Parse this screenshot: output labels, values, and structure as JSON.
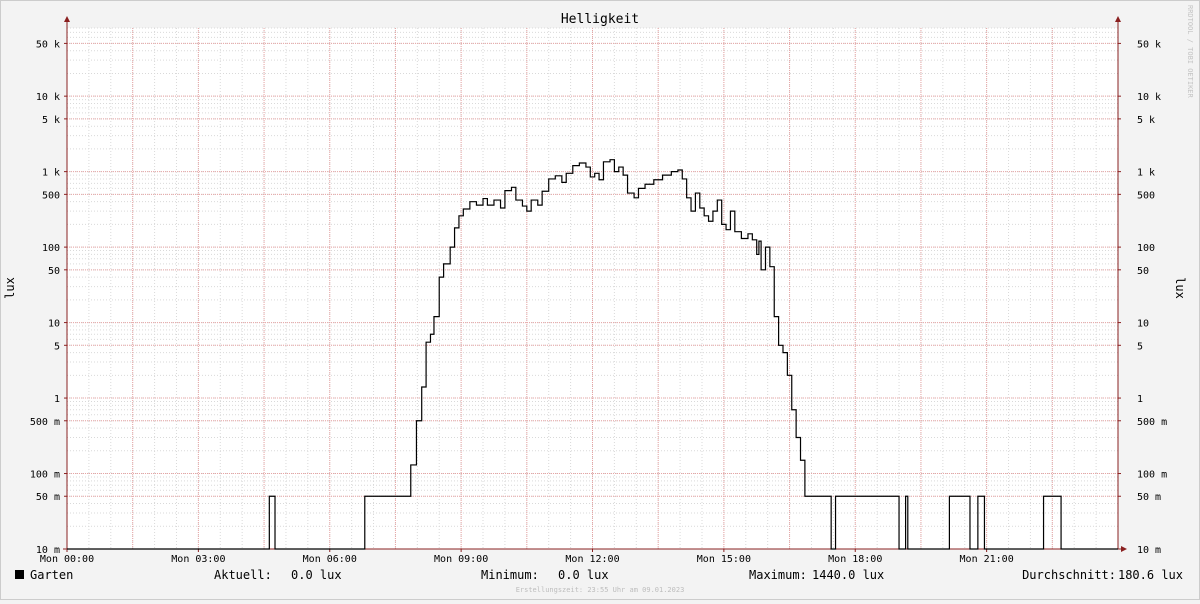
{
  "chart_data": {
    "type": "line",
    "title": "Helligkeit",
    "ylabel": "lux",
    "ylabel_right": "lux",
    "y_scale": "log",
    "ylim": [
      0.01,
      80000
    ],
    "xlim_hours": [
      0,
      24
    ],
    "y_ticks": [
      {
        "value": 0.01,
        "label": "10 m"
      },
      {
        "value": 0.05,
        "label": "50 m"
      },
      {
        "value": 0.1,
        "label": "100 m"
      },
      {
        "value": 0.5,
        "label": "500 m"
      },
      {
        "value": 1,
        "label": "1"
      },
      {
        "value": 5,
        "label": "5"
      },
      {
        "value": 10,
        "label": "10"
      },
      {
        "value": 50,
        "label": "50"
      },
      {
        "value": 100,
        "label": "100"
      },
      {
        "value": 500,
        "label": "500"
      },
      {
        "value": 1000,
        "label": "1 k"
      },
      {
        "value": 5000,
        "label": "5 k"
      },
      {
        "value": 10000,
        "label": "10 k"
      },
      {
        "value": 50000,
        "label": "50 k"
      }
    ],
    "x_ticks": [
      {
        "hour": 0,
        "label": "Mon 00:00"
      },
      {
        "hour": 3,
        "label": "Mon 03:00"
      },
      {
        "hour": 6,
        "label": "Mon 06:00"
      },
      {
        "hour": 9,
        "label": "Mon 09:00"
      },
      {
        "hour": 12,
        "label": "Mon 12:00"
      },
      {
        "hour": 15,
        "label": "Mon 15:00"
      },
      {
        "hour": 18,
        "label": "Mon 18:00"
      },
      {
        "hour": 21,
        "label": "Mon 21:00"
      }
    ],
    "grid": true,
    "series": [
      {
        "name": "Garten",
        "color": "#000000",
        "points": [
          [
            0.0,
            0.01
          ],
          [
            4.62,
            0.01
          ],
          [
            4.62,
            0.05
          ],
          [
            4.75,
            0.05
          ],
          [
            4.75,
            0.01
          ],
          [
            6.8,
            0.01
          ],
          [
            6.8,
            0.05
          ],
          [
            7.85,
            0.05
          ],
          [
            7.85,
            0.13
          ],
          [
            7.98,
            0.13
          ],
          [
            7.98,
            0.5
          ],
          [
            8.1,
            0.5
          ],
          [
            8.1,
            1.4
          ],
          [
            8.2,
            1.4
          ],
          [
            8.2,
            5.5
          ],
          [
            8.3,
            5.5
          ],
          [
            8.3,
            7
          ],
          [
            8.38,
            7
          ],
          [
            8.38,
            12
          ],
          [
            8.5,
            12
          ],
          [
            8.5,
            40
          ],
          [
            8.6,
            40
          ],
          [
            8.6,
            60
          ],
          [
            8.75,
            60
          ],
          [
            8.75,
            100
          ],
          [
            8.85,
            100
          ],
          [
            8.85,
            180
          ],
          [
            8.95,
            180
          ],
          [
            8.95,
            260
          ],
          [
            9.05,
            260
          ],
          [
            9.05,
            320
          ],
          [
            9.2,
            320
          ],
          [
            9.2,
            400
          ],
          [
            9.35,
            400
          ],
          [
            9.35,
            360
          ],
          [
            9.5,
            360
          ],
          [
            9.5,
            440
          ],
          [
            9.6,
            440
          ],
          [
            9.6,
            360
          ],
          [
            9.75,
            360
          ],
          [
            9.75,
            420
          ],
          [
            9.9,
            420
          ],
          [
            9.9,
            330
          ],
          [
            10.0,
            330
          ],
          [
            10.0,
            560
          ],
          [
            10.15,
            560
          ],
          [
            10.15,
            620
          ],
          [
            10.25,
            620
          ],
          [
            10.25,
            420
          ],
          [
            10.4,
            420
          ],
          [
            10.4,
            350
          ],
          [
            10.5,
            350
          ],
          [
            10.5,
            300
          ],
          [
            10.6,
            300
          ],
          [
            10.6,
            420
          ],
          [
            10.75,
            420
          ],
          [
            10.75,
            360
          ],
          [
            10.85,
            360
          ],
          [
            10.85,
            550
          ],
          [
            11.0,
            550
          ],
          [
            11.0,
            800
          ],
          [
            11.15,
            800
          ],
          [
            11.15,
            880
          ],
          [
            11.3,
            880
          ],
          [
            11.3,
            720
          ],
          [
            11.4,
            720
          ],
          [
            11.4,
            950
          ],
          [
            11.55,
            950
          ],
          [
            11.55,
            1200
          ],
          [
            11.7,
            1200
          ],
          [
            11.7,
            1300
          ],
          [
            11.85,
            1300
          ],
          [
            11.85,
            1150
          ],
          [
            11.95,
            1150
          ],
          [
            11.95,
            850
          ],
          [
            12.05,
            850
          ],
          [
            12.05,
            950
          ],
          [
            12.15,
            950
          ],
          [
            12.15,
            780
          ],
          [
            12.25,
            780
          ],
          [
            12.25,
            1350
          ],
          [
            12.4,
            1350
          ],
          [
            12.4,
            1440
          ],
          [
            12.5,
            1440
          ],
          [
            12.5,
            1000
          ],
          [
            12.6,
            1000
          ],
          [
            12.6,
            1150
          ],
          [
            12.7,
            1150
          ],
          [
            12.7,
            900
          ],
          [
            12.8,
            900
          ],
          [
            12.8,
            520
          ],
          [
            12.95,
            520
          ],
          [
            12.95,
            450
          ],
          [
            13.05,
            450
          ],
          [
            13.05,
            600
          ],
          [
            13.2,
            600
          ],
          [
            13.2,
            680
          ],
          [
            13.4,
            680
          ],
          [
            13.4,
            780
          ],
          [
            13.6,
            780
          ],
          [
            13.6,
            900
          ],
          [
            13.8,
            900
          ],
          [
            13.8,
            1000
          ],
          [
            13.95,
            1000
          ],
          [
            13.95,
            1050
          ],
          [
            14.05,
            1050
          ],
          [
            14.05,
            800
          ],
          [
            14.15,
            800
          ],
          [
            14.15,
            450
          ],
          [
            14.25,
            450
          ],
          [
            14.25,
            300
          ],
          [
            14.35,
            300
          ],
          [
            14.35,
            520
          ],
          [
            14.45,
            520
          ],
          [
            14.45,
            330
          ],
          [
            14.55,
            330
          ],
          [
            14.55,
            260
          ],
          [
            14.65,
            260
          ],
          [
            14.65,
            220
          ],
          [
            14.75,
            220
          ],
          [
            14.75,
            300
          ],
          [
            14.85,
            300
          ],
          [
            14.85,
            420
          ],
          [
            14.95,
            420
          ],
          [
            14.95,
            200
          ],
          [
            15.05,
            200
          ],
          [
            15.05,
            170
          ],
          [
            15.15,
            170
          ],
          [
            15.15,
            300
          ],
          [
            15.25,
            300
          ],
          [
            15.25,
            160
          ],
          [
            15.4,
            160
          ],
          [
            15.4,
            130
          ],
          [
            15.55,
            130
          ],
          [
            15.55,
            150
          ],
          [
            15.65,
            150
          ],
          [
            15.65,
            125
          ],
          [
            15.75,
            125
          ],
          [
            15.75,
            80
          ],
          [
            15.8,
            80
          ],
          [
            15.8,
            120
          ],
          [
            15.85,
            120
          ],
          [
            15.85,
            50
          ],
          [
            15.95,
            50
          ],
          [
            15.95,
            100
          ],
          [
            16.05,
            100
          ],
          [
            16.05,
            55
          ],
          [
            16.15,
            55
          ],
          [
            16.15,
            12
          ],
          [
            16.25,
            12
          ],
          [
            16.25,
            5
          ],
          [
            16.35,
            5
          ],
          [
            16.35,
            4
          ],
          [
            16.45,
            4
          ],
          [
            16.45,
            2
          ],
          [
            16.55,
            2
          ],
          [
            16.55,
            0.7
          ],
          [
            16.65,
            0.7
          ],
          [
            16.65,
            0.3
          ],
          [
            16.75,
            0.3
          ],
          [
            16.75,
            0.15
          ],
          [
            16.85,
            0.15
          ],
          [
            16.85,
            0.05
          ],
          [
            17.45,
            0.05
          ],
          [
            17.45,
            0.01
          ],
          [
            17.55,
            0.01
          ],
          [
            17.55,
            0.05
          ],
          [
            19.0,
            0.05
          ],
          [
            19.0,
            0.01
          ],
          [
            19.15,
            0.01
          ],
          [
            19.15,
            0.05
          ],
          [
            19.2,
            0.05
          ],
          [
            19.2,
            0.01
          ],
          [
            20.15,
            0.01
          ],
          [
            20.15,
            0.05
          ],
          [
            20.62,
            0.05
          ],
          [
            20.62,
            0.01
          ],
          [
            20.8,
            0.01
          ],
          [
            20.8,
            0.05
          ],
          [
            20.95,
            0.05
          ],
          [
            20.95,
            0.01
          ],
          [
            22.3,
            0.01
          ],
          [
            22.3,
            0.05
          ],
          [
            22.7,
            0.05
          ],
          [
            22.7,
            0.01
          ],
          [
            24.0,
            0.01
          ]
        ]
      }
    ],
    "legend": {
      "placement": "bottom-left",
      "series_label": "Garten",
      "current_label": "Aktuell:",
      "current_value": "0.0 lux",
      "min_label": "Minimum:",
      "min_value": "0.0 lux",
      "max_label": "Maximum:",
      "max_value": "1440.0 lux",
      "avg_label": "Durchschnitt:",
      "avg_value": "180.6 lux"
    },
    "footer": "Erstellungszeit: 23:55 Uhr am 09.01.2023",
    "watermark": "RRDTOOL / TOBI OETIKER",
    "colors": {
      "background": "#f3f3f3",
      "canvas": "#ffffff",
      "major_grid": "#e8a4a4",
      "minor_grid": "#d9d9d9",
      "axis": "#8a2020",
      "line": "#000000"
    }
  }
}
